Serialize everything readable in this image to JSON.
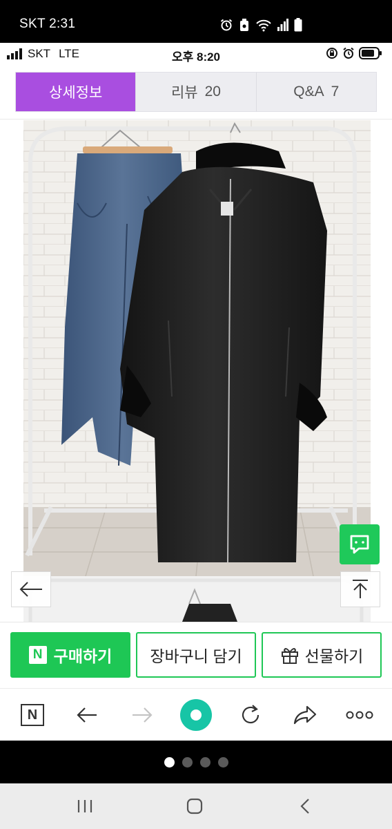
{
  "outer_status": {
    "time": "SKT 2:31"
  },
  "inner_status": {
    "carrier": "SKT",
    "network": "LTE",
    "time": "오후 8:20"
  },
  "tabs": [
    {
      "label": "상세정보",
      "count": "",
      "active": true
    },
    {
      "label": "리뷰",
      "count": "20",
      "active": false
    },
    {
      "label": "Q&A",
      "count": "7",
      "active": false
    }
  ],
  "product_image": {
    "alt": ""
  },
  "buy_bar": {
    "npay_logo": "N",
    "npay_label": "구매하기",
    "cart_label": "장바구니 담기",
    "gift_label": "선물하기"
  },
  "browser_bar": {
    "naver_logo": "N"
  },
  "pager": {
    "count": 4,
    "active_index": 0
  },
  "colors": {
    "accent_purple": "#a94ee0",
    "npay_green": "#1ec755",
    "home_teal": "#17c5a6"
  }
}
